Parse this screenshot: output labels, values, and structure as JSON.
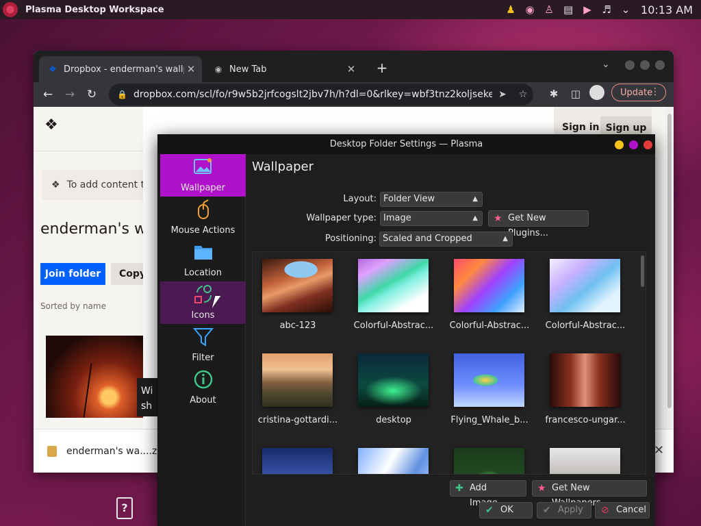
{
  "panel": {
    "app_title": "Plasma Desktop Workspace",
    "clock": "10:13 AM",
    "tray_icons": [
      "user-icon",
      "firefox-icon",
      "person-icon",
      "clipboard-icon",
      "audio-muted-icon",
      "volume-icon",
      "chevron-down-icon"
    ]
  },
  "browser": {
    "tabs": [
      {
        "label": "Dropbox - enderman's wallpa",
        "close": "✕"
      },
      {
        "label": "New Tab",
        "close": "✕"
      }
    ],
    "new_tab": "+",
    "url": "dropbox.com/scl/fo/r9w5b2jrfcogslt2jbv7h/h?dl=0&rlkey=wbf3tnz2koljsekee...",
    "update_label": "Update"
  },
  "dropbox_page": {
    "sign_in": "Sign in",
    "sign_up": "Sign up",
    "notice": "To add content t",
    "folder_title": "enderman's w",
    "join_folder": "Join folder",
    "copy": "Copy",
    "sorted": "Sorted by name",
    "tooltip": "Wi\nsh",
    "download_name": "enderman's wa....zi"
  },
  "dialog": {
    "title": "Desktop Folder Settings — Plasma",
    "categories": [
      {
        "label": "Wallpaper",
        "icon": "wallpaper-icon"
      },
      {
        "label": "Mouse Actions",
        "icon": "mouse-icon"
      },
      {
        "label": "Location",
        "icon": "folder-icon"
      },
      {
        "label": "Icons",
        "icon": "icons-icon"
      },
      {
        "label": "Filter",
        "icon": "filter-icon"
      },
      {
        "label": "About",
        "icon": "info-icon"
      }
    ],
    "heading": "Wallpaper",
    "layout_label": "Layout:",
    "layout_value": "Folder View",
    "wallpaper_type_label": "Wallpaper type:",
    "wallpaper_type_value": "Image",
    "get_plugins": "Get New Plugins...",
    "positioning_label": "Positioning:",
    "positioning_value": "Scaled and Cropped",
    "wallpapers": [
      {
        "name": "abc-123"
      },
      {
        "name": "Colorful-Abstrac..."
      },
      {
        "name": "Colorful-Abstrac..."
      },
      {
        "name": "Colorful-Abstrac..."
      },
      {
        "name": "cristina-gottardi..."
      },
      {
        "name": "desktop"
      },
      {
        "name": "Flying_Whale_b..."
      },
      {
        "name": "francesco-ungar..."
      },
      {
        "name": ""
      },
      {
        "name": ""
      },
      {
        "name": ""
      },
      {
        "name": ""
      }
    ],
    "add_image": "Add Image...",
    "get_wallpapers": "Get New Wallpapers...",
    "ok": "OK",
    "apply": "Apply",
    "cancel": "Cancel"
  },
  "colors": {
    "accent": "#b012c9",
    "panel_bg": "#2a1a24",
    "dropbox_blue": "#0061fe"
  }
}
